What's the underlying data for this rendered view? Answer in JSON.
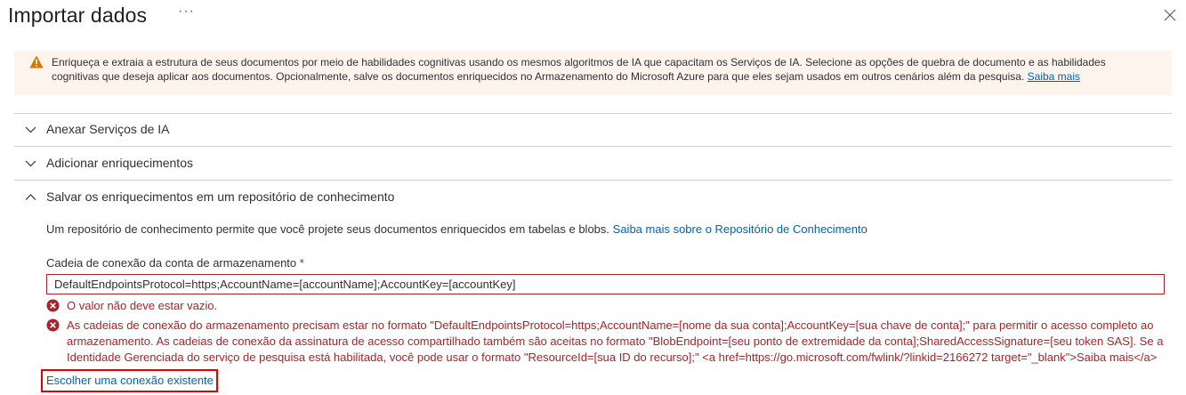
{
  "header": {
    "title": "Importar dados",
    "more_label": "···"
  },
  "banner": {
    "text": "Enriqueça e extraia a estrutura de seus documentos por meio de habilidades cognitivas usando os mesmos algoritmos de IA que capacitam os Serviços de IA. Selecione as opções de quebra de documento e as habilidades cognitivas que deseja aplicar aos documentos. Opcionalmente, salve os documentos enriquecidos no Armazenamento do Microsoft Azure para que eles sejam usados em outros cenários além da pesquisa.",
    "link": "Saiba mais",
    "icon": "warning-icon",
    "color": "#fdf4ee"
  },
  "sections": [
    {
      "label": "Anexar Serviços de IA",
      "expanded": false
    },
    {
      "label": "Adicionar enriquecimentos",
      "expanded": false
    },
    {
      "label": "Salvar os enriquecimentos em um repositório de conhecimento",
      "expanded": true
    }
  ],
  "knowledge_store": {
    "description": "Um repositório de conhecimento permite que você projete seus documentos enriquecidos em tabelas e blobs.",
    "description_link": "Saiba mais sobre o Repositório de Conhecimento",
    "field_label": "Cadeia de conexão da conta de armazenamento",
    "required_marker": "*",
    "input_value": "DefaultEndpointsProtocol=https;AccountName=[accountName];AccountKey=[accountKey]",
    "errors": [
      "O valor não deve estar vazio.",
      "As cadeias de conexão do armazenamento precisam estar no formato \"DefaultEndpointsProtocol=https;AccountName=[nome da sua conta];AccountKey=[sua chave de conta];\" para permitir o acesso completo ao armazenamento. As cadeias de conexão da assinatura de acesso compartilhado também são aceitas no formato \"BlobEndpoint=[seu ponto de extremidade da conta];SharedAccessSignature=[seu token SAS]. Se a Identidade Gerenciada do serviço de pesquisa está habilitada, você pode usar o formato \"ResourceId=[sua ID do recurso];\" <a href=https://go.microsoft.com/fwlink/?linkid=2166272 target=\"_blank\">Saiba mais</a>"
    ],
    "choose_link": "Escolher uma conexão existente"
  },
  "colors": {
    "link": "#0063b1",
    "error": "#a4262c",
    "highlight": "#e00000"
  }
}
